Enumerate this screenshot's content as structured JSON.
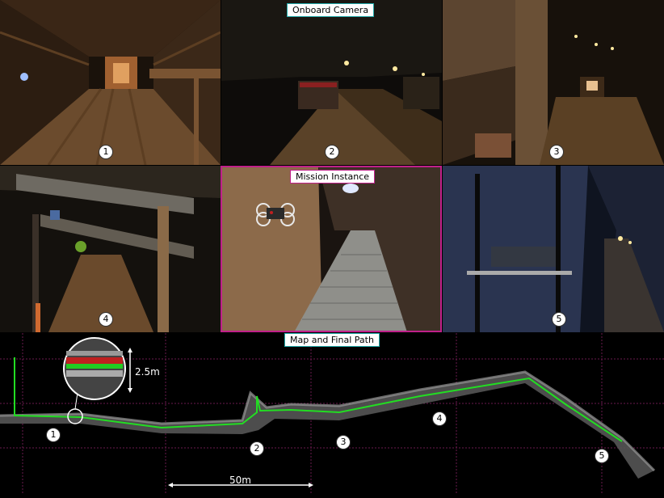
{
  "labels": {
    "onboard_camera": "Onboard Camera",
    "mission_instance": "Mission Instance",
    "map_and_final_path": "Map and Final Path"
  },
  "markers": {
    "m1": "1",
    "m2": "2",
    "m3": "3",
    "m4": "4",
    "m5": "5"
  },
  "map_markers": {
    "m1": "1",
    "m2": "2",
    "m3": "3",
    "m4": "4",
    "m5": "5"
  },
  "dimensions": {
    "height": "2.5m",
    "scale": "50m"
  },
  "colors": {
    "path": "#22dd22",
    "grid": "#7a1f5a",
    "map_bg": "#000000",
    "mission_frame": "#c0208a",
    "camera_label_border": "#22aaaa"
  }
}
